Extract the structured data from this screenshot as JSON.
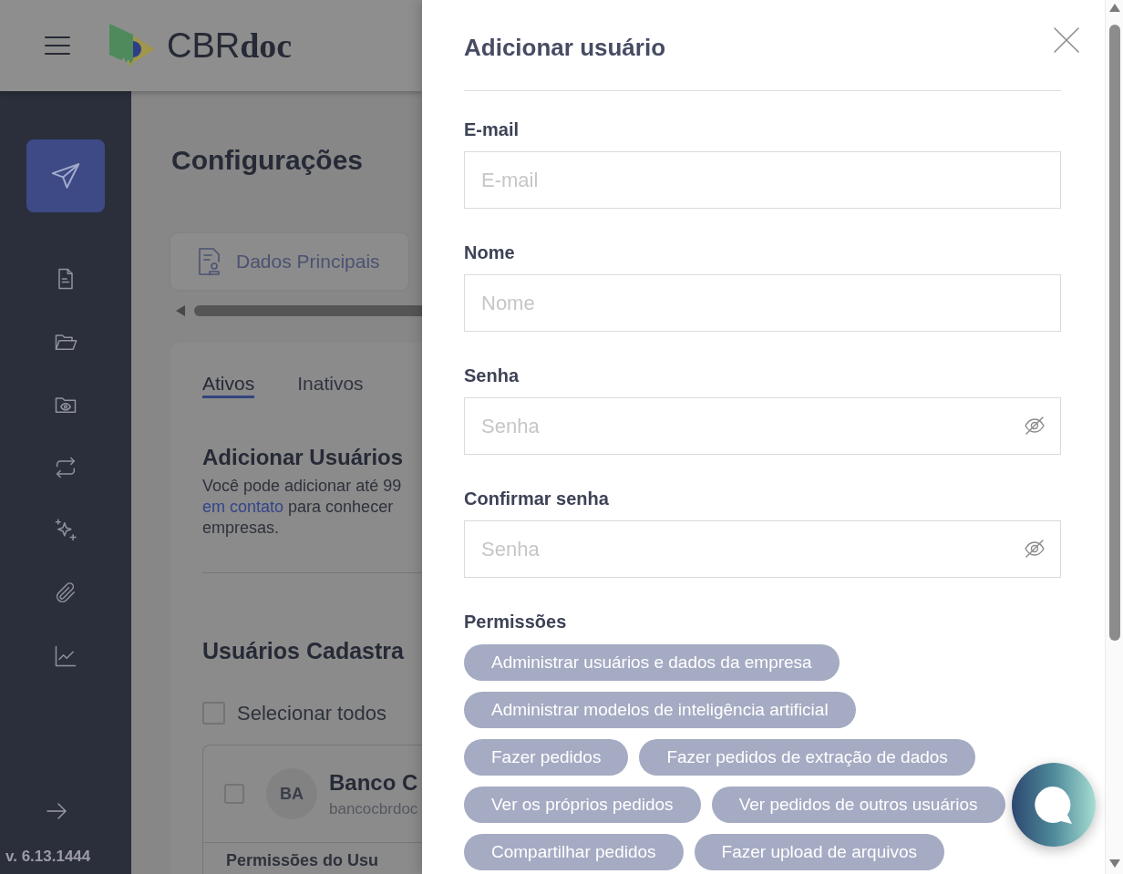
{
  "header": {
    "logo": "CBR**doc**"
  },
  "sidebar": {
    "items": [
      {
        "selected": false
      },
      {
        "selected": false
      },
      {
        "selected": false
      },
      {
        "selected": false
      },
      {
        "selected": false
      },
      {
        "selected": false
      },
      {
        "selected": false
      }
    ],
    "version": "v. 6.13.1444"
  },
  "page": {
    "title": "Configurações",
    "section_tabs": [
      {
        "label": "Dados Principais"
      }
    ],
    "user_tabs": [
      {
        "label": "Ativos",
        "selected": true
      },
      {
        "label": "Inativos",
        "selected": false
      }
    ],
    "add_users": {
      "title": "Adicionar Usuários",
      "description": [
        {
          "text": "Você pode adicionar até 99"
        },
        {
          "link": "em contato",
          "text": " para conhecer"
        },
        {
          "text": "empresas."
        }
      ]
    },
    "registered_users": {
      "title": "Usuários Cadastra",
      "select_all": {
        "label": "Selecionar todos",
        "checked": false
      },
      "users": [
        {
          "initials": "BA",
          "name": "Banco C",
          "email": "bancocbrdoc",
          "checked": false,
          "section_title": "Permissões do Usu"
        }
      ]
    }
  },
  "modal": {
    "title": "Adicionar usuário",
    "fields": [
      {
        "kind": "text",
        "label": "E-mail",
        "placeholder": "E-mail"
      },
      {
        "kind": "text",
        "label": "Nome",
        "placeholder": "Nome"
      },
      {
        "kind": "password",
        "label": "Senha",
        "placeholder": "Senha"
      },
      {
        "kind": "password",
        "label": "Confirmar senha",
        "placeholder": "Senha"
      }
    ],
    "permissions": {
      "label": "Permissões",
      "items": [
        {
          "label": "Administrar usuários e dados da empresa",
          "selected": false
        },
        {
          "label": "Administrar modelos de inteligência artificial",
          "selected": false
        },
        {
          "label": "Fazer pedidos",
          "selected": false
        },
        {
          "label": "Fazer pedidos de extração de dados",
          "selected": false
        },
        {
          "label": "Ver os próprios pedidos",
          "selected": false
        },
        {
          "label": "Ver pedidos de outros usuários",
          "selected": false
        },
        {
          "label": "Compartilhar pedidos",
          "selected": false
        },
        {
          "label": "Fazer upload de arquivos",
          "selected": false
        }
      ]
    }
  }
}
